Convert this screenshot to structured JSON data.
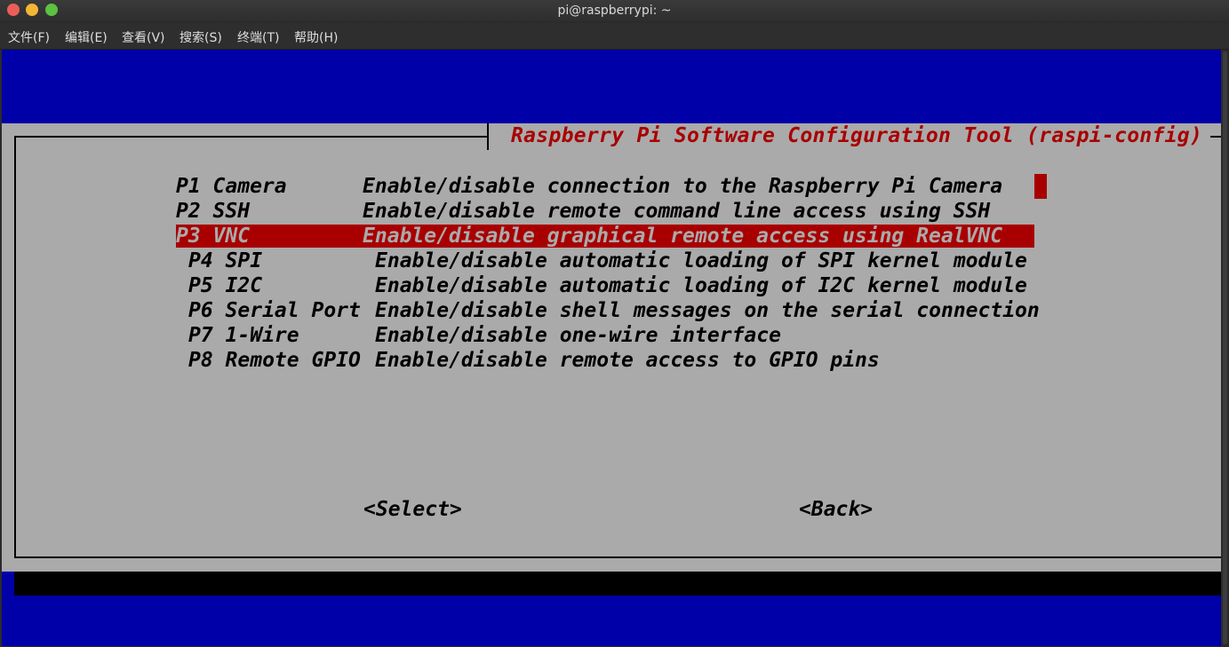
{
  "window": {
    "title": "pi@raspberrypi: ~"
  },
  "menubar": {
    "items": [
      {
        "label": "文件(F)"
      },
      {
        "label": "编辑(E)"
      },
      {
        "label": "查看(V)"
      },
      {
        "label": "搜索(S)"
      },
      {
        "label": "终端(T)"
      },
      {
        "label": "帮助(H)"
      }
    ]
  },
  "dialog": {
    "title": "Raspberry Pi Software Configuration Tool (raspi-config)",
    "options": [
      {
        "key": "P1 Camera",
        "desc": "Enable/disable connection to the Raspberry Pi Camera",
        "selected": false
      },
      {
        "key": "P2 SSH",
        "desc": "Enable/disable remote command line access using SSH",
        "selected": false
      },
      {
        "key": "P3 VNC",
        "desc": "Enable/disable graphical remote access using RealVNC",
        "selected": true
      },
      {
        "key": "P4 SPI",
        "desc": "Enable/disable automatic loading of SPI kernel module",
        "selected": false
      },
      {
        "key": "P5 I2C",
        "desc": "Enable/disable automatic loading of I2C kernel module",
        "selected": false
      },
      {
        "key": "P6 Serial Port",
        "desc": "Enable/disable shell messages on the serial connection",
        "selected": false
      },
      {
        "key": "P7 1-Wire",
        "desc": "Enable/disable one-wire interface",
        "selected": false
      },
      {
        "key": "P8 Remote GPIO",
        "desc": "Enable/disable remote access to GPIO pins",
        "selected": false
      }
    ],
    "select_label": "<Select>",
    "back_label": "<Back>"
  },
  "colors": {
    "terminal_bg": "#0000a8",
    "dialog_bg": "#aaaaaa",
    "accent_red": "#a80000"
  }
}
